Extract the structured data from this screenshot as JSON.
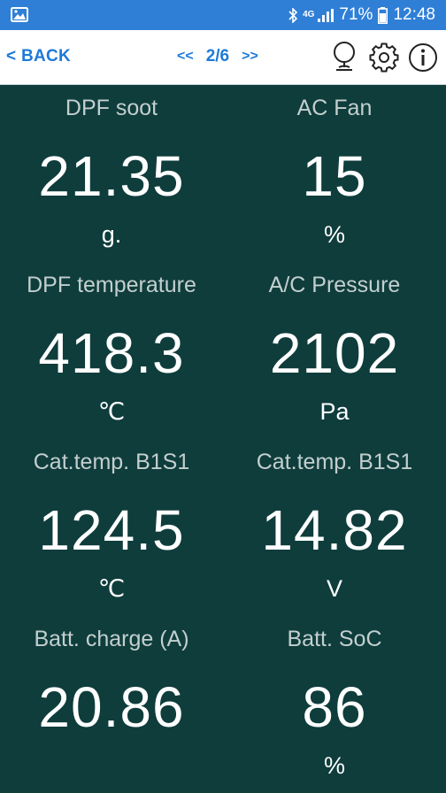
{
  "status_bar": {
    "battery": "71%",
    "time": "12:48",
    "network": "4G"
  },
  "toolbar": {
    "back_label": "< BACK",
    "prev_label": "<<",
    "page_indicator": "2/6",
    "next_label": ">>"
  },
  "gauges": [
    {
      "label": "DPF soot",
      "value": "21.35",
      "unit": "g."
    },
    {
      "label": "AC Fan",
      "value": "15",
      "unit": "%"
    },
    {
      "label": "DPF temperature",
      "value": "418.3",
      "unit": "℃"
    },
    {
      "label": "A/C Pressure",
      "value": "2102",
      "unit": "Pa"
    },
    {
      "label": "Cat.temp. B1S1",
      "value": "124.5",
      "unit": "℃"
    },
    {
      "label": "Cat.temp. B1S1",
      "value": "14.82",
      "unit": "V"
    },
    {
      "label": "Batt. charge (A)",
      "value": "20.86",
      "unit": ""
    },
    {
      "label": "Batt. SoC",
      "value": "86",
      "unit": "%"
    }
  ],
  "colors": {
    "status_bar": "#2f7fd6",
    "toolbar_accent": "#1d7ad8",
    "background": "#0e3d3c"
  }
}
